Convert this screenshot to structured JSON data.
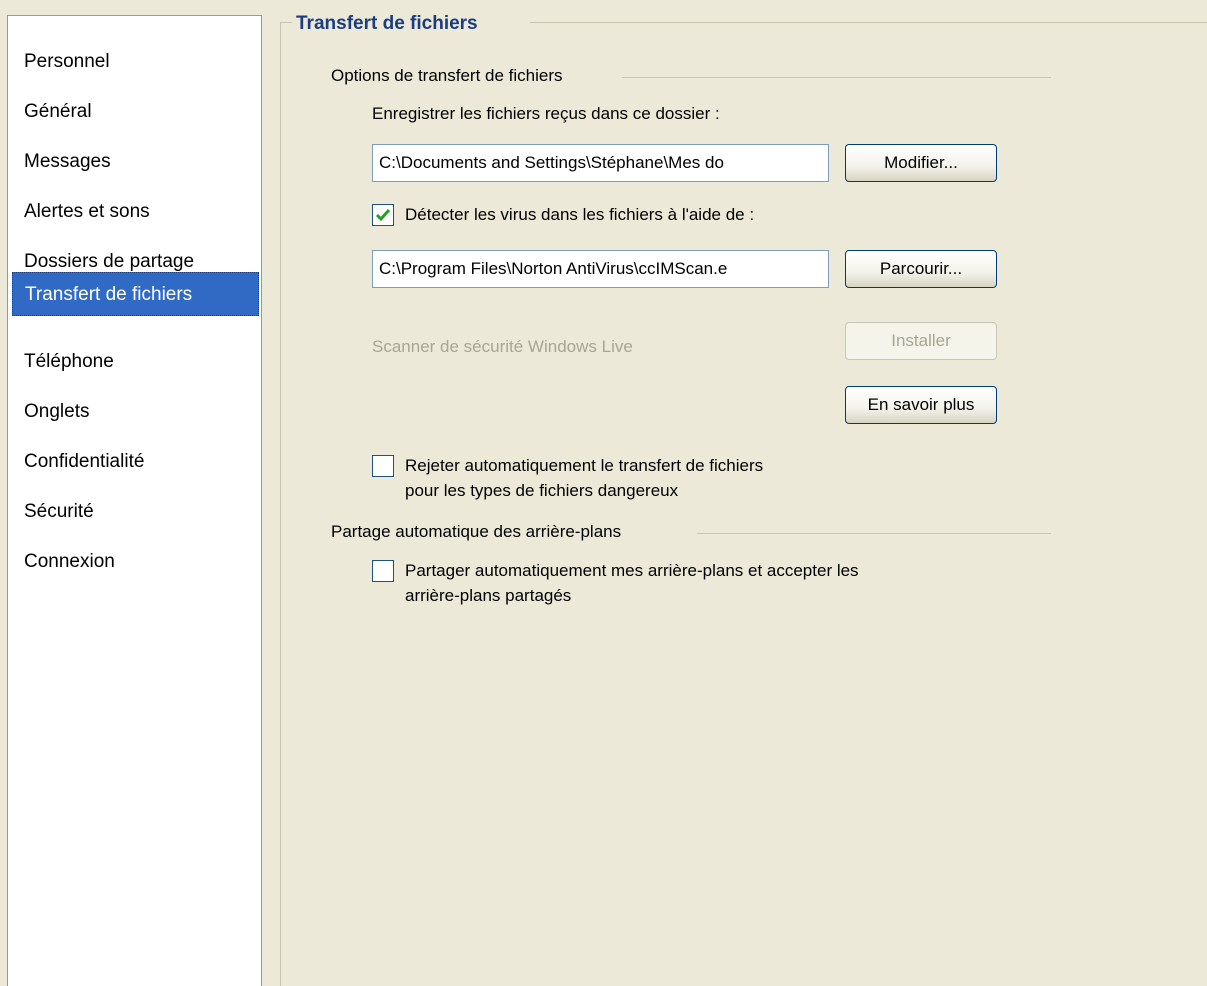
{
  "sidebar": {
    "items": [
      {
        "label": "Personnel"
      },
      {
        "label": "Général"
      },
      {
        "label": "Messages"
      },
      {
        "label": "Alertes et sons"
      },
      {
        "label": "Dossiers de partage"
      },
      {
        "label": "Transfert de fichiers"
      },
      {
        "label": "Téléphone"
      },
      {
        "label": "Onglets"
      },
      {
        "label": "Confidentialité"
      },
      {
        "label": "Sécurité"
      },
      {
        "label": "Connexion"
      }
    ],
    "selected_index": 5
  },
  "main": {
    "title": "Transfert de fichiers",
    "file_options": {
      "heading": "Options de transfert de fichiers",
      "save_folder_label": "Enregistrer les fichiers reçus dans ce dossier :",
      "save_folder_value": "C:\\Documents and Settings\\Stéphane\\Mes do",
      "modify_button": "Modifier...",
      "virus_check_label": "Détecter les virus dans les fichiers à l'aide de :",
      "virus_check_checked": true,
      "virus_scanner_value": "C:\\Program Files\\Norton AntiVirus\\ccIMScan.e",
      "browse_button": "Parcourir...",
      "scanner_label": "Scanner de sécurité Windows Live",
      "install_button": "Installer",
      "learn_more_button": "En savoir plus",
      "reject_label_line1": "Rejeter automatiquement le transfert de fichiers",
      "reject_label_line2": "pour les types de fichiers dangereux",
      "reject_checked": false
    },
    "background_sharing": {
      "heading": "Partage automatique des arrière-plans",
      "share_label_line1": "Partager automatiquement mes arrière-plans et accepter les",
      "share_label_line2": "arrière-plans partagés",
      "share_checked": false
    }
  },
  "colors": {
    "selection": "#316ac5",
    "title": "#1b3d80",
    "window_bg": "#ece9d8",
    "check": "#21a121"
  }
}
